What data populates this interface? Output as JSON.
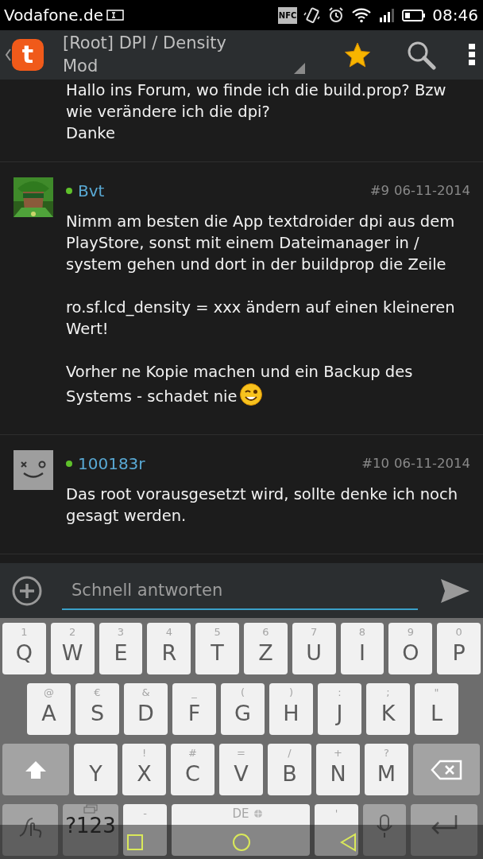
{
  "status_bar": {
    "carrier": "Vodafone.de",
    "nfc": "NFC",
    "time": "08:46"
  },
  "toolbar": {
    "app_logo": "t",
    "title": "[Root] DPI / Density Mod"
  },
  "posts": [
    {
      "paragraphs": [
        "Hallo ins Forum, wo finde ich die build.prop? Bzw wie verändere ich die dpi?\nDanke"
      ],
      "ends_with_emoji": false
    },
    {
      "author": "Bvt",
      "online": true,
      "avatar": {
        "kind": "picture"
      },
      "number": "#9",
      "date": "06-11-2014",
      "paragraphs": [
        "Nimm am besten die App textdroider dpi aus dem PlayStore, sonst mit einem Dateimanager in / system gehen und dort in der buildprop die Zeile",
        "ro.sf.lcd_density = xxx ändern auf einen kleineren Wert!",
        "Vorher ne Kopie machen und ein Backup des Systems - schadet nie"
      ],
      "ends_with_emoji": true
    },
    {
      "author": "100183r",
      "online": true,
      "avatar": {
        "kind": "default"
      },
      "number": "#10",
      "date": "06-11-2014",
      "paragraphs": [
        "Das root vorausgesetzt wird, sollte denke ich noch gesagt werden."
      ],
      "ends_with_emoji": false
    }
  ],
  "reply": {
    "placeholder": "Schnell antworten"
  },
  "keyboard": {
    "rows": [
      {
        "keys": [
          {
            "kind": "letter",
            "label": "Q",
            "hint": "1"
          },
          {
            "kind": "letter",
            "label": "W",
            "hint": "2"
          },
          {
            "kind": "letter",
            "label": "E",
            "hint": "3"
          },
          {
            "kind": "letter",
            "label": "R",
            "hint": "4"
          },
          {
            "kind": "letter",
            "label": "T",
            "hint": "5"
          },
          {
            "kind": "letter",
            "label": "Z",
            "hint": "6"
          },
          {
            "kind": "letter",
            "label": "U",
            "hint": "7"
          },
          {
            "kind": "letter",
            "label": "I",
            "hint": "8"
          },
          {
            "kind": "letter",
            "label": "O",
            "hint": "9"
          },
          {
            "kind": "letter",
            "label": "P",
            "hint": "0"
          }
        ]
      },
      {
        "keys": [
          {
            "kind": "letter",
            "label": "A",
            "hint": "@"
          },
          {
            "kind": "letter",
            "label": "S",
            "hint": "€"
          },
          {
            "kind": "letter",
            "label": "D",
            "hint": "&"
          },
          {
            "kind": "letter",
            "label": "F",
            "hint": "_"
          },
          {
            "kind": "letter",
            "label": "G",
            "hint": "("
          },
          {
            "kind": "letter",
            "label": "H",
            "hint": ")"
          },
          {
            "kind": "letter",
            "label": "J",
            "hint": ":"
          },
          {
            "kind": "letter",
            "label": "K",
            "hint": ";"
          },
          {
            "kind": "letter",
            "label": "L",
            "hint": "\""
          }
        ]
      },
      {
        "keys": [
          {
            "kind": "shift"
          },
          {
            "kind": "letter",
            "label": "Y"
          },
          {
            "kind": "letter",
            "label": "X",
            "hint": "!"
          },
          {
            "kind": "letter",
            "label": "C",
            "hint": "#"
          },
          {
            "kind": "letter",
            "label": "V",
            "hint": "="
          },
          {
            "kind": "letter",
            "label": "B",
            "hint": "/"
          },
          {
            "kind": "letter",
            "label": "N",
            "hint": "+"
          },
          {
            "kind": "letter",
            "label": "M",
            "hint": "?"
          },
          {
            "kind": "backspace"
          }
        ]
      },
      {
        "keys": [
          {
            "kind": "gesture"
          },
          {
            "kind": "symbols",
            "label": "?123"
          },
          {
            "kind": "letter",
            "hint": "-"
          },
          {
            "kind": "space",
            "hint": "DE"
          },
          {
            "kind": "letter",
            "hint": "'"
          },
          {
            "kind": "mic"
          },
          {
            "kind": "enter"
          }
        ]
      }
    ]
  }
}
